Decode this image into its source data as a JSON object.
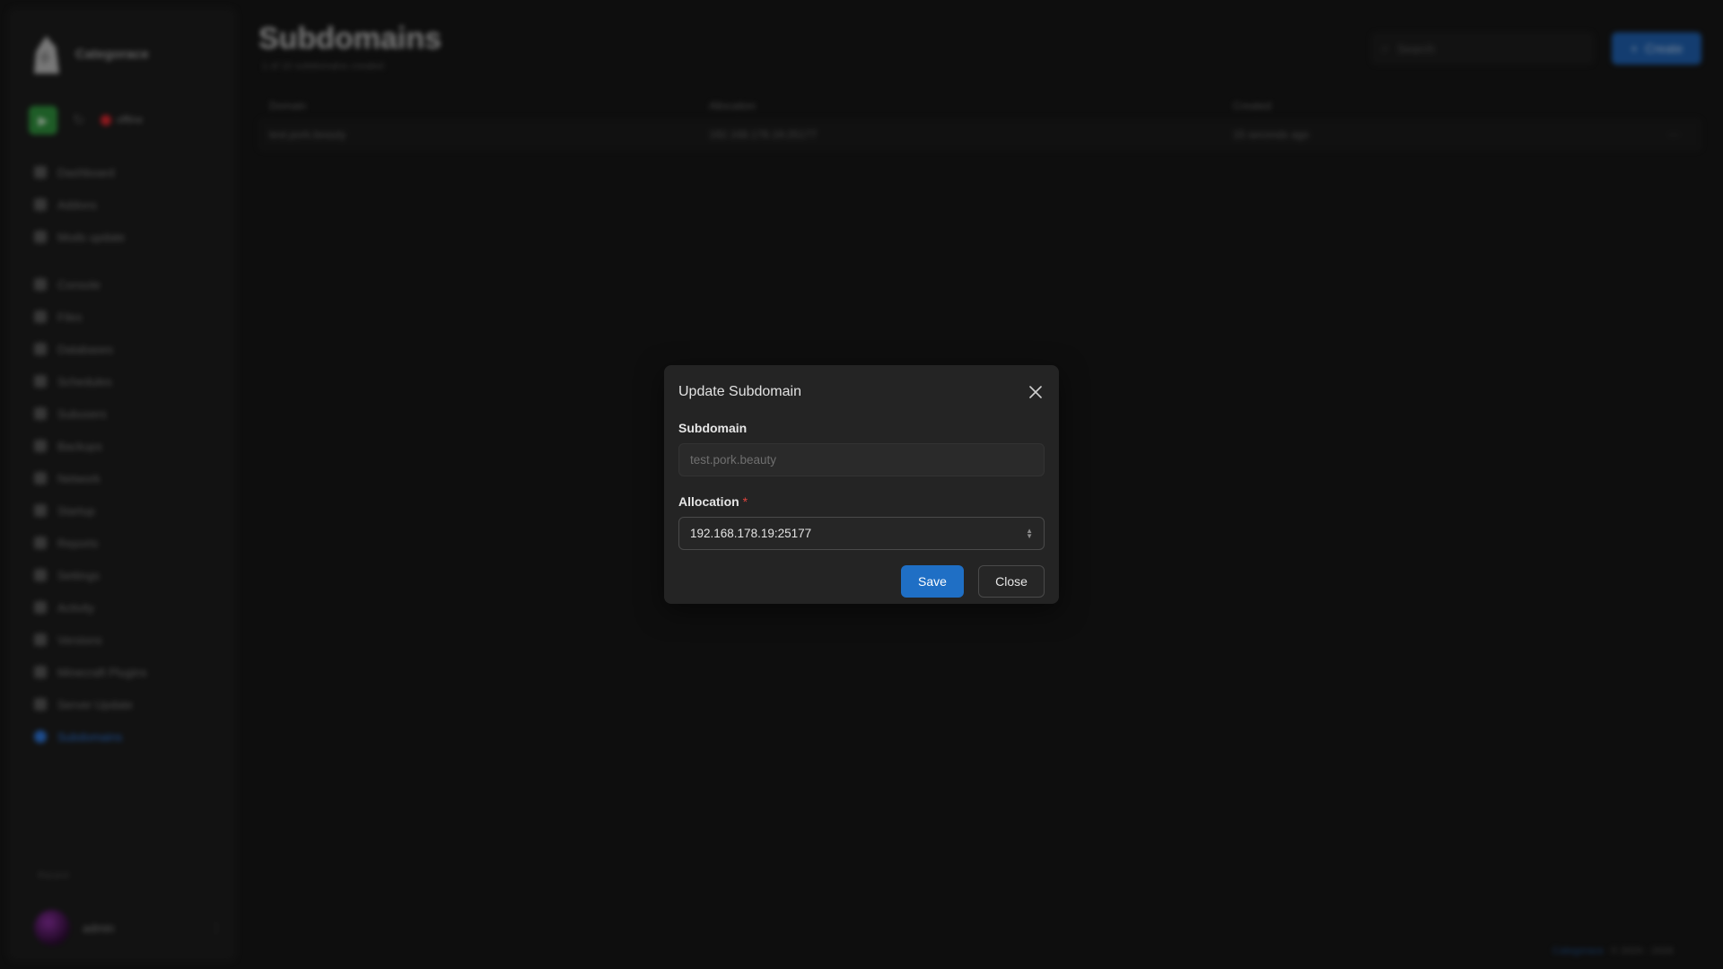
{
  "sidebar": {
    "brand": "Categorace",
    "status": "offline",
    "nav_group1": [
      "Dashboard",
      "Addons",
      "Mods update"
    ],
    "nav_group2": [
      "Console",
      "Files",
      "Databases",
      "Schedules",
      "Subusers",
      "Backups",
      "Network",
      "Startup",
      "Reports",
      "Settings",
      "Activity",
      "Versions",
      "Minecraft Plugins",
      "Server Update",
      "Subdomains"
    ],
    "recent_label": "Recent",
    "user_name": "admin"
  },
  "main": {
    "title": "Subdomains",
    "subtitle": "1 of 10 subdomains created",
    "search_placeholder": "Search",
    "create_label": "Create",
    "columns": [
      "Domain",
      "Allocation",
      "Created"
    ],
    "rows": [
      {
        "domain": "test.pork.beauty",
        "allocation": "192.168.178.19:25177",
        "created": "15 seconds ago"
      }
    ],
    "footer_link": "Categorace",
    "footer_text": "© 2024 - 2026"
  },
  "modal": {
    "title": "Update Subdomain",
    "subdomain_label": "Subdomain",
    "subdomain_value": "test.pork.beauty",
    "allocation_label": "Allocation",
    "allocation_required": "*",
    "allocation_value": "192.168.178.19:25177",
    "save_label": "Save",
    "close_label": "Close"
  },
  "colors": {
    "accent": "#1f6fc5",
    "danger": "#e0443e",
    "power_on": "#2f8f3c"
  }
}
